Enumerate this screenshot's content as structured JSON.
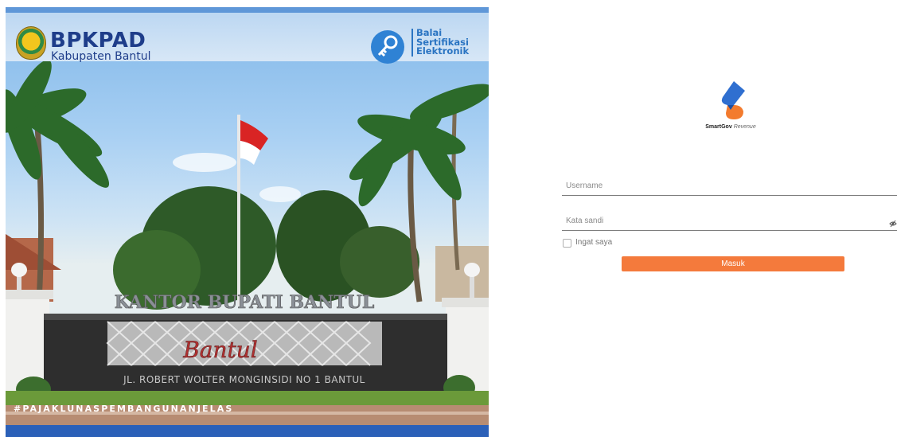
{
  "banner": {
    "org_title": "BPKPAD",
    "org_subtitle": "Kabupaten Bantul",
    "partner_line1": "Balai",
    "partner_line2": "Sertifikasi",
    "partner_line3": "Elektronik",
    "building_sign": "KANTOR BUPATI BANTUL",
    "city_script": "Bantul",
    "address_sign": "JL. ROBERT WOLTER MONGINSIDI NO 1 BANTUL",
    "hashtag": "#PAJAKLUNASPEMBANGUNANJELAS"
  },
  "brand": {
    "name_bold": "SmartGov",
    "name_italic": "Revenue"
  },
  "login": {
    "username_placeholder": "Username",
    "password_placeholder": "Kata sandi",
    "remember_label": "Ingat saya",
    "submit_label": "Masuk"
  },
  "colors": {
    "accent": "#f47a3c",
    "banner_blue": "#1e3d8a",
    "band_blue": "#2b60b8"
  },
  "icons": {
    "password_toggle": "eye-slash-icon",
    "brand_logo": "smartgov-logo-icon"
  }
}
